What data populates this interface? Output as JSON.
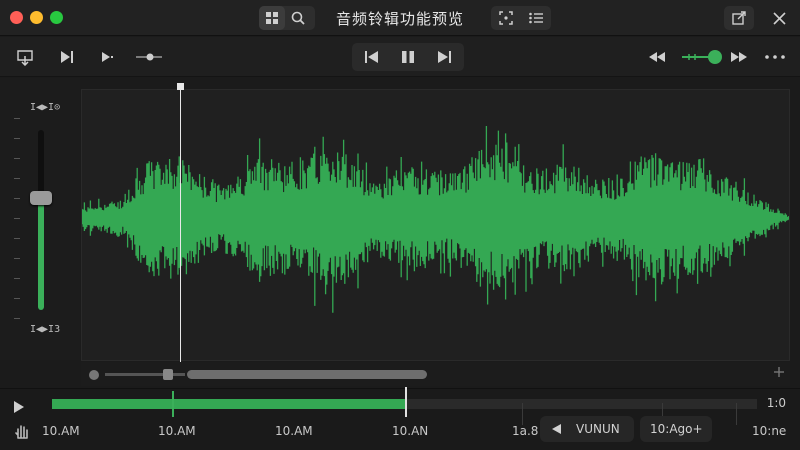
{
  "window": {
    "title": "音频铃辑功能预览"
  },
  "colors": {
    "accent": "#3bb05a",
    "waveform": "#34a853",
    "background": "#1b1b1b"
  },
  "gain": {
    "top_label": "Ι◀▶Ι⊙",
    "bottom_label": "Ι◀▶Ι3",
    "level": 0.62
  },
  "timeline": {
    "progress": 0.5,
    "total": "1:0",
    "labels": [
      "10.AM",
      "10.AM",
      "10.AM",
      "10.AN",
      "1a.8",
      "VUNUN",
      "10:Ago+",
      "10:ne"
    ]
  },
  "icons": {
    "titlebar": [
      "grid-icon",
      "search-icon",
      "focus-icon",
      "list-icon",
      "share-icon",
      "close-icon"
    ],
    "toolbar": [
      "import-icon",
      "play-next-icon",
      "play-icon",
      "level-icon",
      "skip-back-icon",
      "pause-icon",
      "skip-forward-icon",
      "rewind-icon",
      "volume-slider-icon",
      "fast-forward-icon",
      "more-icon"
    ]
  }
}
